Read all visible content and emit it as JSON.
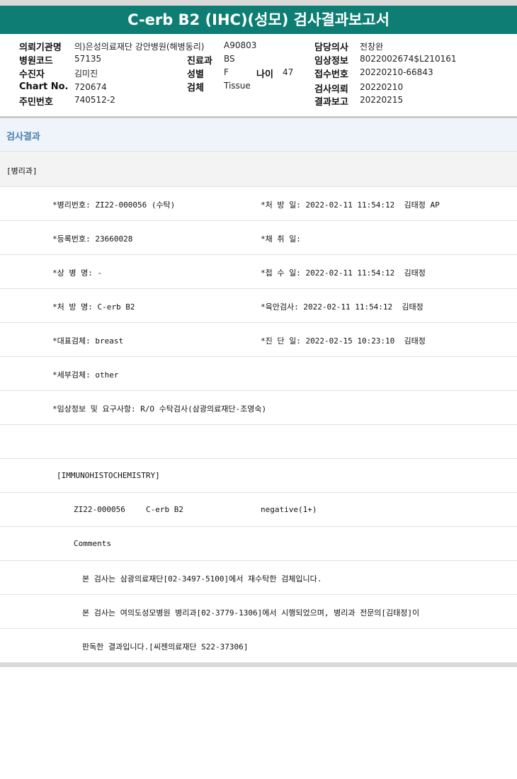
{
  "title": "C-erb B2 (IHC)(성모) 검사결과보고서",
  "info": {
    "institution_label": "의뢰기관명",
    "institution_value": "의)은성의료재단 강안병원(해병동리)",
    "institution_code": "A90803",
    "doctor_label": "담당의사",
    "doctor_value": "전창완",
    "hospital_code_label": "병원코드",
    "hospital_code_value": "57135",
    "department_label": "진료과",
    "department_value": "BS",
    "clinical_info_label": "임상정보",
    "clinical_info_value": "8022002674$L210161",
    "patient_label": "수진자",
    "patient_value": "김미진",
    "sex_label": "성별",
    "sex_value": "F",
    "age_label": "나이",
    "age_value": "47",
    "receipt_label": "접수번호",
    "receipt_value": "20220210-66843",
    "chart_label": "Chart No.",
    "chart_value": "720674",
    "specimen_label": "검체",
    "specimen_value": "Tissue",
    "request_label": "검사의뢰",
    "request_value": "20220210",
    "resident_label": "주민번호",
    "resident_value": "740512-2",
    "report_label": "결과보고",
    "report_value": "20220215"
  },
  "results_header": "검사결과",
  "dept": "[병리과]",
  "fields": {
    "pathology_no": "*병리번호: ZI22-000056 (수탁)",
    "order_date": "*처 방 일: 2022-02-11 11:54:12  김태정 AP",
    "registration_no": "*등록번호: 23660028",
    "collection_date": "*채 취 일:",
    "disease_name": "*상 병 명: -",
    "receipt_date": "*접 수 일: 2022-02-11 11:54:12  김태정",
    "prescription": "*처 방 명: C-erb B2",
    "gross_exam": "*육안검사: 2022-02-11 11:54:12  김태정",
    "representative_specimen": "*대표검체: breast",
    "diagnosis_date": "*진 단 일: 2022-02-15 10:23:10  김태정",
    "detail_specimen": "*세부검체: other",
    "clinical_request": "*임상정보 및 요구사항: R/O 수탁검사(삼광의료재단-조영숙)"
  },
  "ihc_header": "[IMMUNOHISTOCHEMISTRY]",
  "ihc_result": {
    "case_no": "ZI22-000056",
    "marker": "C-erb B2",
    "result": "negative(1+)"
  },
  "comments_label": "Comments",
  "comments": [
    "본 검사는 삼광의료재단[02-3497-5100]에서 재수탁한 검체입니다.",
    "본 검사는 여의도성모병원 병리과[02-3779-1306]에서 시행되었으며, 병리과 전문의[김태정]이",
    "판독한 결과입니다.[씨젠의료재단 S22-37306]"
  ],
  "colors": {
    "title_bar": "#0e7d73",
    "results_header_bg": "#eef4f9",
    "results_header_text": "#4d7fb0"
  }
}
